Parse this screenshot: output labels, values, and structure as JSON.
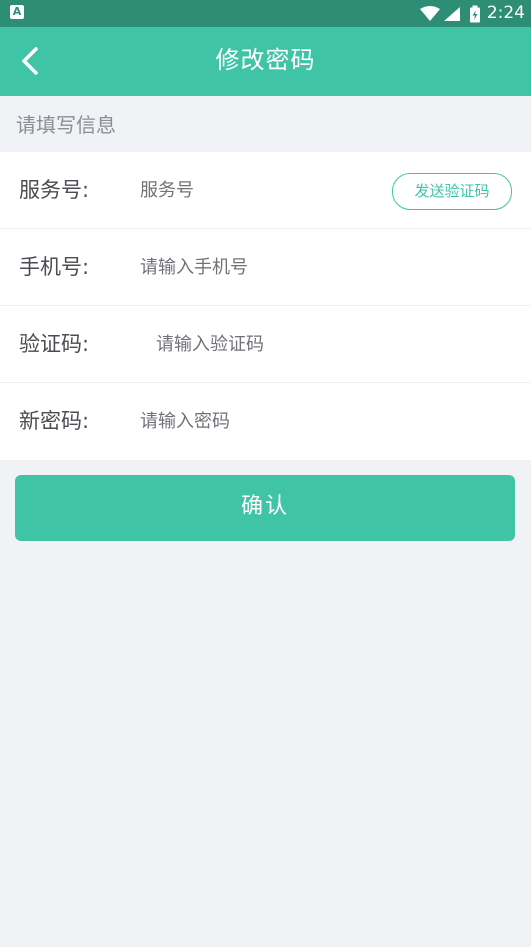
{
  "status_bar": {
    "notification_badge": "A",
    "time": "2:24",
    "icons": [
      "wifi-icon",
      "signal-icon",
      "battery-icon"
    ]
  },
  "header": {
    "title": "修改密码",
    "back_icon": "chevron-left-icon"
  },
  "section": {
    "title": "请填写信息"
  },
  "form": {
    "service_number": {
      "label": "服务号:",
      "value": "",
      "placeholder": "服务号"
    },
    "phone": {
      "label": "手机号:",
      "value": "",
      "placeholder": "请输入手机号"
    },
    "verification_code": {
      "label": "验证码:",
      "value": "",
      "placeholder": "请输入验证码",
      "send_button_label": "发送验证码"
    },
    "new_password": {
      "label": "新密码:",
      "value": "",
      "placeholder": "请输入密码"
    }
  },
  "confirm_label": "确认",
  "colors": {
    "primary": "#40c4a6",
    "status_bar": "#2d8e75",
    "background": "#f0f2f6",
    "card": "#ffffff",
    "label_text": "#4a4d52",
    "placeholder_text": "#6f7277",
    "section_text": "#8a8e95"
  }
}
